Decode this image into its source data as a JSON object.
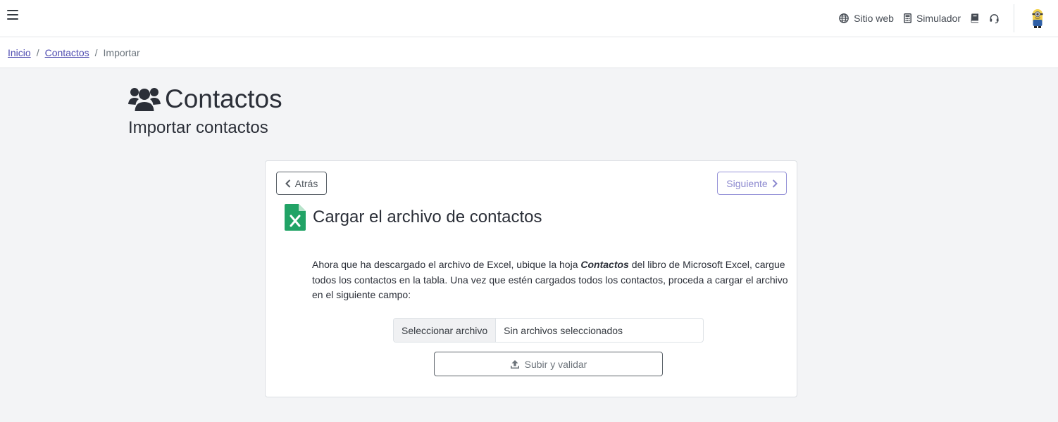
{
  "topbar": {
    "nav": {
      "website_label": "Sitio web",
      "simulator_label": "Simulador"
    },
    "icons": [
      "menu-icon",
      "globe-icon",
      "calculator-icon",
      "book-icon",
      "headset-icon",
      "user-avatar"
    ]
  },
  "breadcrumb": {
    "home": "Inicio",
    "contacts": "Contactos",
    "current": "Importar"
  },
  "page": {
    "title": "Contactos",
    "subtitle": "Importar contactos"
  },
  "card": {
    "back_label": "Atrás",
    "next_label": "Siguiente",
    "section_title": "Cargar el archivo de contactos",
    "desc_before": "Ahora que ha descargado el archivo de Excel, ubique la hoja ",
    "desc_bold": "Contactos",
    "desc_after": " del libro de Microsoft Excel, cargue todos los contactos en la tabla. Una vez que estén cargados todos los contactos, proceda a cargar el archivo en el siguiente campo:",
    "file_button": "Seleccionar archivo",
    "file_status": "Sin archivos seleccionados",
    "upload_label": "Subir y validar"
  },
  "colors": {
    "accent": "#4e4bb0",
    "excel_green": "#21a366",
    "text_dark": "#2b2f38",
    "background": "#f3f4f6"
  }
}
